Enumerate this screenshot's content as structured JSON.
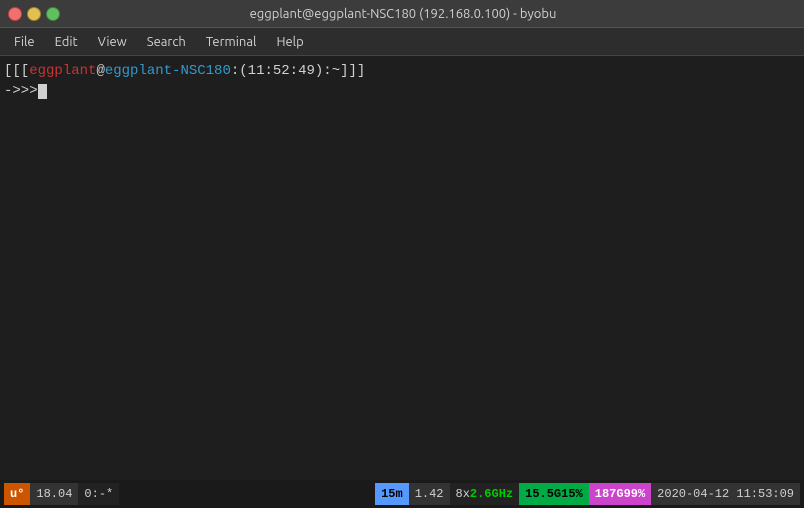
{
  "titlebar": {
    "title": "eggplant@eggplant-NSC180 (192.168.0.100) - byobu"
  },
  "menubar": {
    "items": [
      "File",
      "Edit",
      "View",
      "Search",
      "Terminal",
      "Help"
    ]
  },
  "terminal": {
    "prompt_line1_parts": {
      "outer_open": "[[[",
      "username": "eggplant",
      "at": "@",
      "hostname": "eggplant-NSC180",
      "rest": ":(11:52:49):~]]]"
    },
    "prompt_line2": "->>> "
  },
  "statusbar": {
    "u_label": "u°",
    "ubuntu_version": "18.04",
    "session": "0:-*",
    "mem_window_label": "15m",
    "load_avg": "1.42",
    "cpu_cores": "8x",
    "cpu_freq": "2.6GHz",
    "mem_usage": "15.5G",
    "mem_pct": "15%",
    "disk_used": "187G",
    "disk_pct": "99%",
    "date": "2020-04-12",
    "time": "11:53:09"
  }
}
